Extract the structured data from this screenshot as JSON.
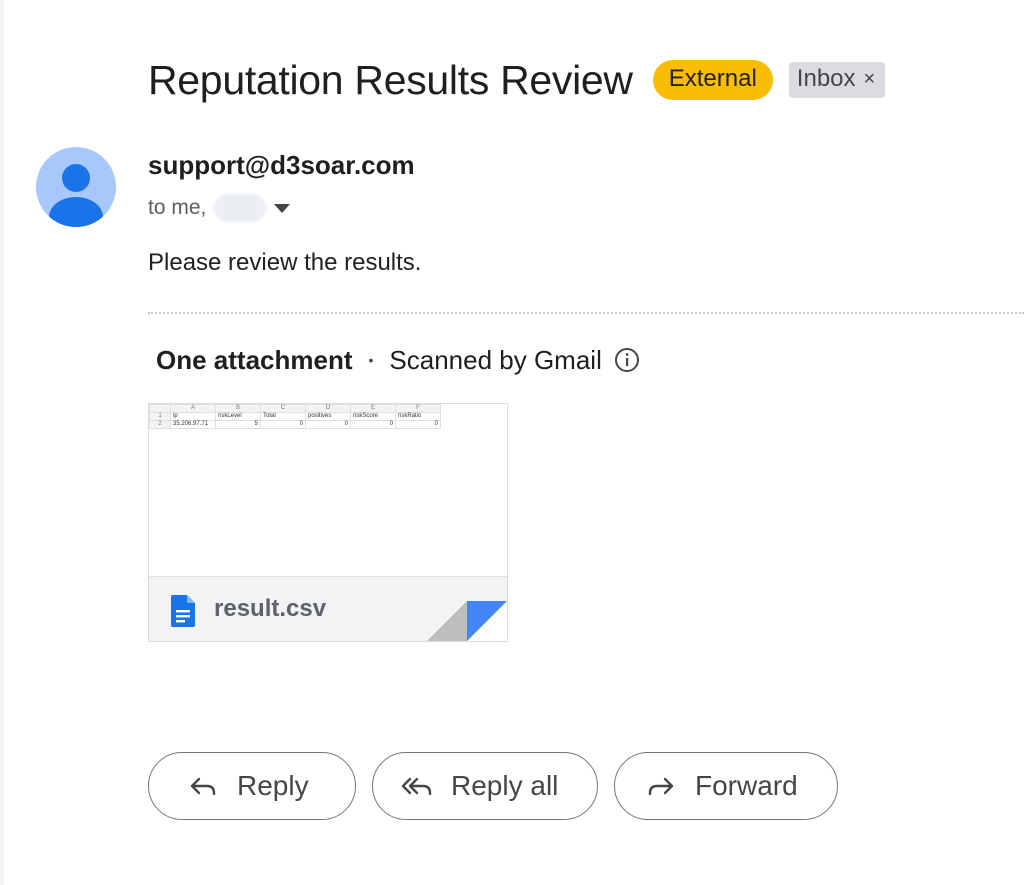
{
  "message": {
    "subject": "Reputation Results Review",
    "labels": {
      "external": "External",
      "inbox": "Inbox",
      "inbox_remove": "×"
    },
    "sender": "support@d3soar.com",
    "recipients_prefix": "to me,",
    "body": "Please review the results."
  },
  "attachments": {
    "title": "One attachment",
    "separator": "•",
    "scanned_text": "Scanned by Gmail",
    "files": [
      {
        "name": "result.csv",
        "icon": "google-sheets-document-icon",
        "preview": {
          "columns": [
            "A",
            "B",
            "C",
            "D",
            "E",
            "F"
          ],
          "rows": [
            [
              "1",
              "ip",
              "riskLevel",
              "Total",
              "positives",
              "riskScore",
              "riskRatio"
            ],
            [
              "2",
              "35.206.97.71",
              "5",
              "0",
              "0",
              "0",
              "0"
            ]
          ]
        }
      }
    ]
  },
  "actions": {
    "reply": "Reply",
    "reply_all": "Reply all",
    "forward": "Forward"
  },
  "colors": {
    "external_label": "#fbbc04",
    "inbox_label": "#dadce0",
    "avatar_bg": "#a8c7fa",
    "avatar_fg": "#1a73e8",
    "file_icon": "#1a73e8"
  }
}
